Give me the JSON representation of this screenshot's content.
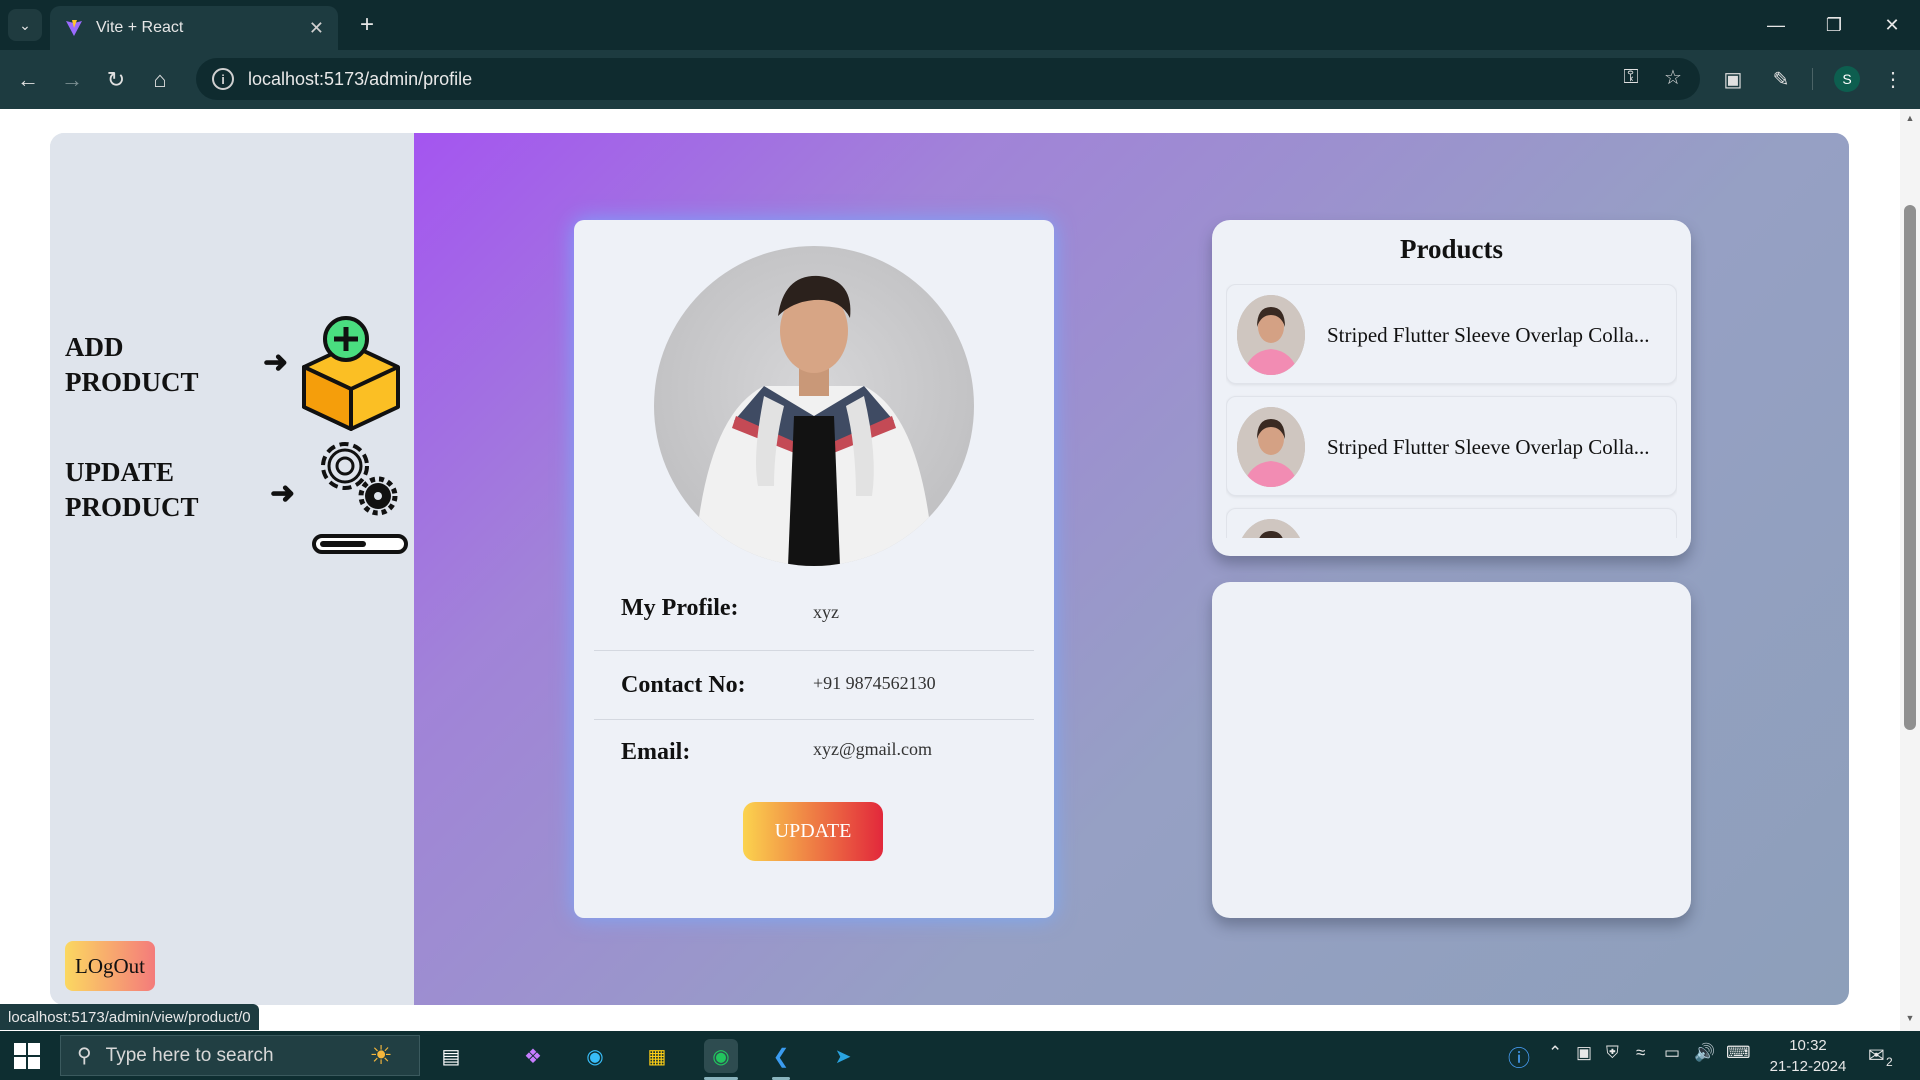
{
  "browser": {
    "tab_title": "Vite + React",
    "url": "localhost:5173/admin/profile",
    "profile_initial": "S",
    "status_url": "localhost:5173/admin/view/product/0"
  },
  "sidebar": {
    "add_product": "ADD\nPRODUCT",
    "update_product": "UPDATE\nPRODUCT",
    "logout_label": "LOgOut"
  },
  "profile": {
    "fields": [
      {
        "label": "My Profile:",
        "value": "xyz"
      },
      {
        "label": "Contact No:",
        "value": "+91 9874562130"
      },
      {
        "label": "Email:",
        "value": "xyz@gmail.com"
      }
    ],
    "update_label": "UPDATE"
  },
  "products": {
    "title": "Products",
    "items": [
      {
        "name": "Striped Flutter Sleeve Overlap Colla..."
      },
      {
        "name": "Striped Flutter Sleeve Overlap Colla..."
      },
      {
        "name": ""
      }
    ]
  },
  "taskbar": {
    "search_placeholder": "Type here to search",
    "time": "10:32",
    "date": "21-12-2024",
    "notification_count": "2"
  },
  "colors": {
    "accent_purple": "#a455f0",
    "update_gradient_start": "#fbd34e",
    "update_gradient_end": "#e2283b"
  }
}
